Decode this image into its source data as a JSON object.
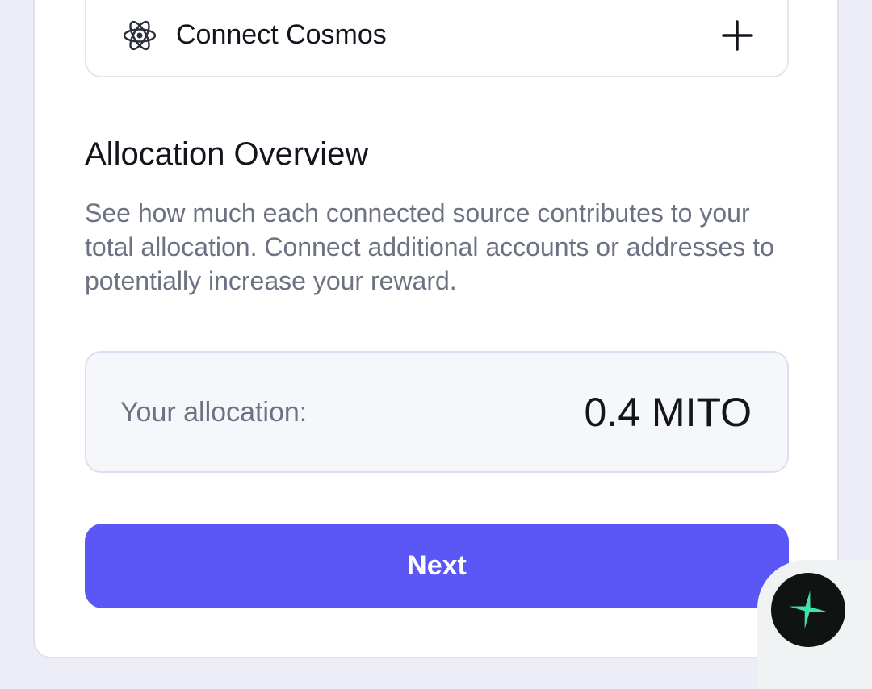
{
  "connect": {
    "label": "Connect Cosmos",
    "icon": "cosmos-atom-icon",
    "action_icon": "plus-icon"
  },
  "allocation_overview": {
    "title": "Allocation Overview",
    "description": "See how much each connected source contributes to your total allocation. Connect additional accounts or addresses to potentially increase your reward."
  },
  "allocation": {
    "label": "Your allocation:",
    "value": "0.4 MITO"
  },
  "actions": {
    "next_label": "Next"
  },
  "floating_button": {
    "icon": "sparkle-icon",
    "color": "#3fe3b0"
  },
  "colors": {
    "accent": "#5b56f6",
    "text_primary": "#14151c",
    "text_secondary": "#6d7282",
    "background": "#ecedf7"
  }
}
